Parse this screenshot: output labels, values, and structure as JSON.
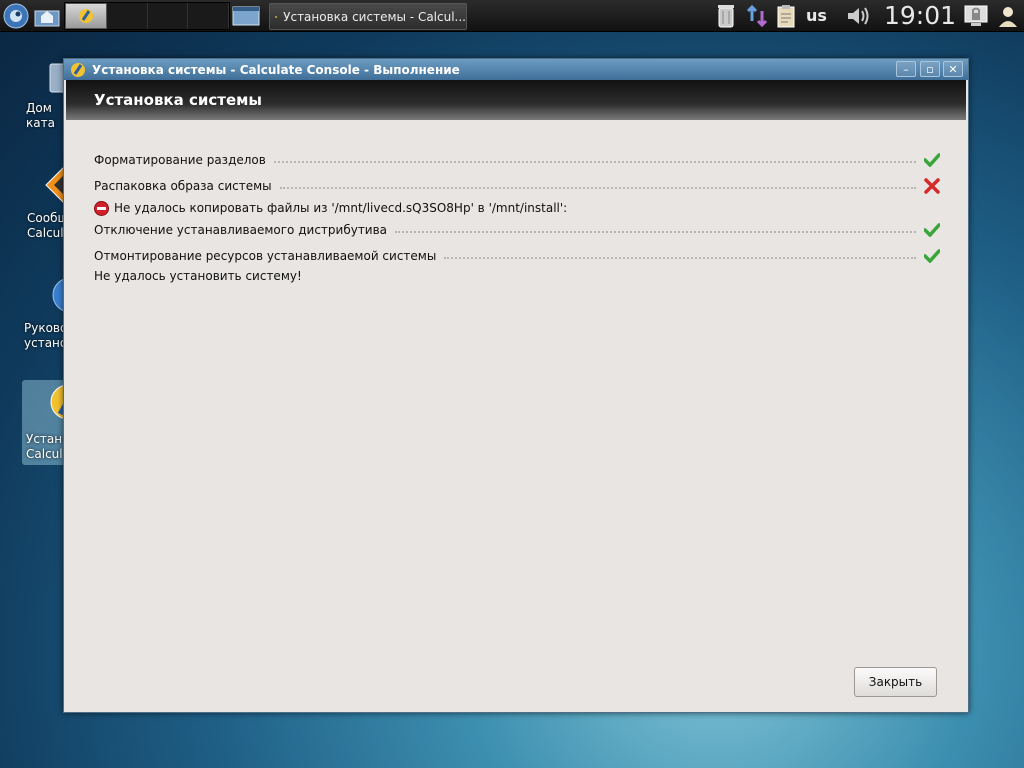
{
  "panel": {
    "task_title": "Установка системы - Calcul...",
    "keyboard_layout": "us",
    "clock": "19:01",
    "icons": [
      "app-menu-icon",
      "home-icon",
      "trash-icon",
      "network-icon",
      "clipboard-icon",
      "volume-icon",
      "lock-screen-icon",
      "user-icon"
    ]
  },
  "desktop": {
    "icons": [
      {
        "name": "home-folder",
        "line1": "Дом",
        "line2": "ката"
      },
      {
        "name": "report-bug",
        "line1": "Сообщ",
        "line2": "Calcul"
      },
      {
        "name": "guide",
        "line1": "Руково",
        "line2": "устано"
      },
      {
        "name": "install",
        "line1": "Устан",
        "line2": "Calcul"
      }
    ]
  },
  "window": {
    "title": "Установка системы - Calculate Console - Выполнение",
    "header": "Установка системы",
    "steps": [
      {
        "label": "Форматирование разделов",
        "status": "ok"
      },
      {
        "label": "Распаковка образа системы",
        "status": "error"
      },
      {
        "label": "Отключение устанавливаемого дистрибутива",
        "status": "ok"
      },
      {
        "label": "Отмонтирование ресурсов устанавливаемой системы",
        "status": "ok"
      }
    ],
    "error_message": "Не удалось копировать файлы из '/mnt/livecd.sQ3SO8Hp' в '/mnt/install':",
    "final_message": "Не удалось установить систему!",
    "close_button": "Закрыть"
  },
  "colors": {
    "ok": "#3aa53a",
    "error": "#d42a2a",
    "titlebar": "#4f80a8"
  }
}
